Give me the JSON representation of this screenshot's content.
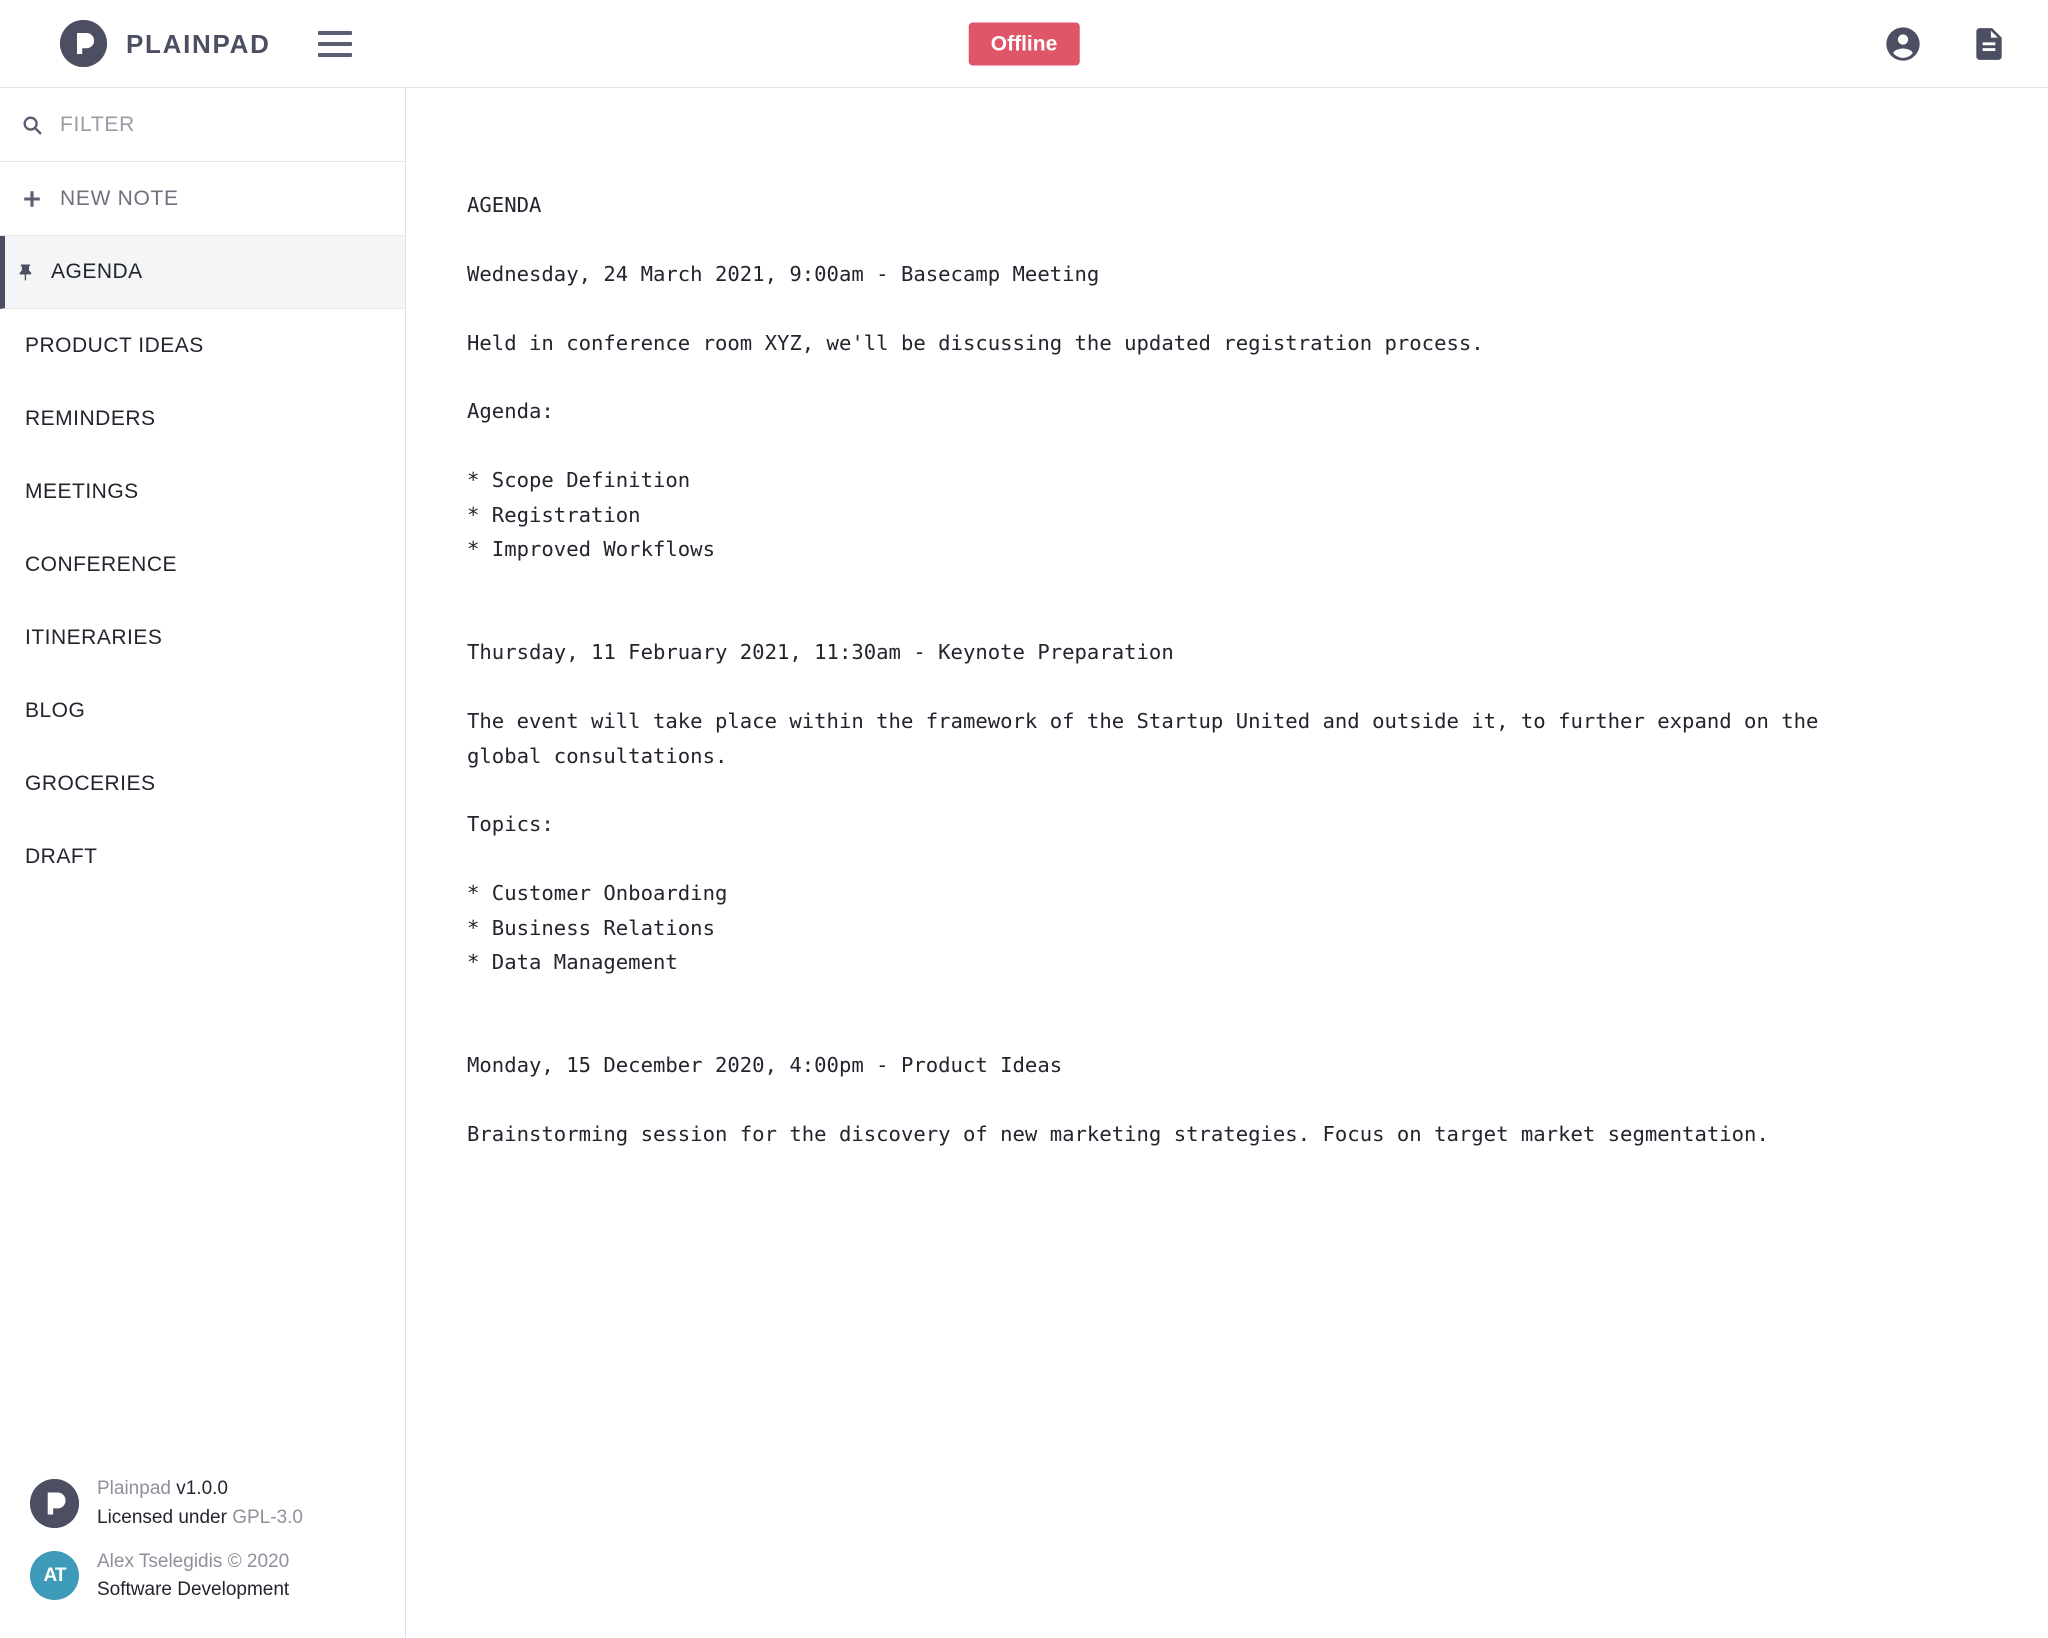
{
  "header": {
    "brand_name": "PLAINPAD",
    "logo_icon": "plainpad-p-logo",
    "menu_icon": "hamburger-menu-icon",
    "status_label": "Offline",
    "status_color": "#de5668",
    "account_icon": "account-circle-icon",
    "notes_icon": "document-file-icon"
  },
  "sidebar": {
    "filter": {
      "icon": "search-icon",
      "placeholder": "FILTER",
      "value": ""
    },
    "new_note": {
      "icon": "plus-icon",
      "label": "NEW NOTE"
    },
    "notes": [
      {
        "label": "AGENDA",
        "pinned": true,
        "selected": true,
        "icon": "pin-icon"
      },
      {
        "label": "PRODUCT IDEAS",
        "pinned": false,
        "selected": false
      },
      {
        "label": "REMINDERS",
        "pinned": false,
        "selected": false
      },
      {
        "label": "MEETINGS",
        "pinned": false,
        "selected": false
      },
      {
        "label": "CONFERENCE",
        "pinned": false,
        "selected": false
      },
      {
        "label": "ITINERARIES",
        "pinned": false,
        "selected": false
      },
      {
        "label": "BLOG",
        "pinned": false,
        "selected": false
      },
      {
        "label": "GROCERIES",
        "pinned": false,
        "selected": false
      },
      {
        "label": "DRAFT",
        "pinned": false,
        "selected": false
      }
    ],
    "footer": {
      "app": {
        "icon": "plainpad-p-logo",
        "line1_muted": "Plainpad ",
        "line1_strong": "v1.0.0",
        "line2_strong": "Licensed under ",
        "line2_muted": "GPL-3.0"
      },
      "author": {
        "icon": "author-avatar",
        "initials": "AT",
        "line1": "Alex Tselegidis © 2020",
        "line2": "Software Development"
      }
    }
  },
  "editor": {
    "title": "AGENDA",
    "content": "AGENDA\n\nWednesday, 24 March 2021, 9:00am - Basecamp Meeting\n\nHeld in conference room XYZ, we'll be discussing the updated registration process.\n\nAgenda:\n\n* Scope Definition\n* Registration\n* Improved Workflows\n\n\nThursday, 11 February 2021, 11:30am - Keynote Preparation\n\nThe event will take place within the framework of the Startup United and outside it, to further expand on the global consultations.\n\nTopics:\n\n* Customer Onboarding\n* Business Relations\n* Data Management\n\n\nMonday, 15 December 2020, 4:00pm - Product Ideas\n\nBrainstorming session for the discovery of new marketing strategies. Focus on target market segmentation.\n"
  }
}
